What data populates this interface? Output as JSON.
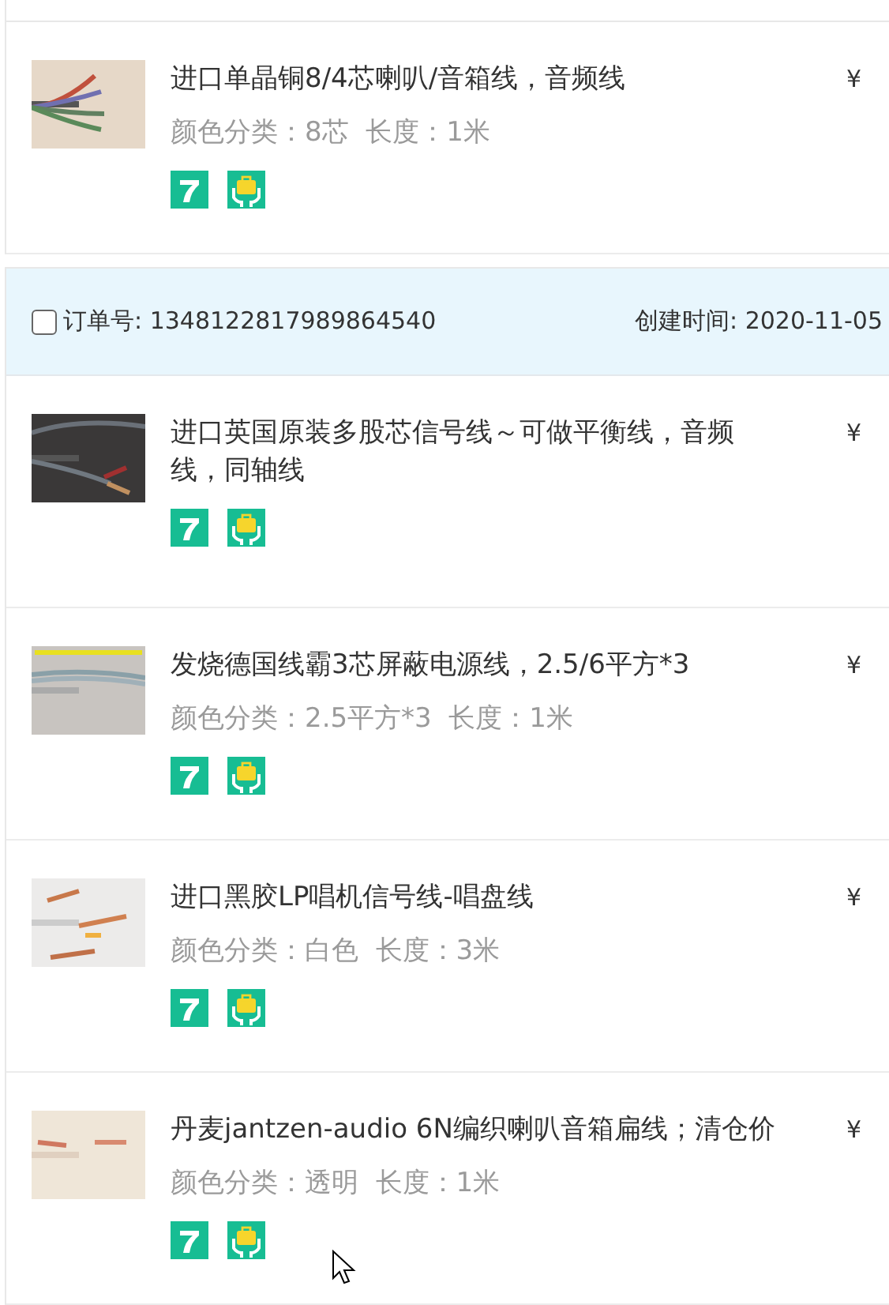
{
  "orders": [
    {
      "items": [
        {
          "title": "进口单晶铜8/4芯喇叭/音箱线，音频线",
          "specs": "颜色分类：8芯  长度：1米",
          "price": "¥"
        }
      ]
    },
    {
      "header": {
        "checked": false,
        "order_label": "订单号: 1348122817989864540",
        "created": "创建时间: 2020-11-05"
      },
      "items": [
        {
          "title": "进口英国原装多股芯信号线～可做平衡线，音频线，同轴线",
          "price": "¥"
        },
        {
          "title": "发烧德国线霸3芯屏蔽电源线，2.5/6平方*3",
          "specs": "颜色分类：2.5平方*3  长度：1米",
          "price": "¥"
        },
        {
          "title": "进口黑胶LP唱机信号线-唱盘线",
          "specs": "颜色分类：白色  长度：3米",
          "price": "¥"
        },
        {
          "title": "丹麦jantzen-audio 6N编织喇叭音箱扁线；清仓价",
          "specs": "颜色分类：透明  长度：1米",
          "price": "¥"
        }
      ]
    }
  ]
}
